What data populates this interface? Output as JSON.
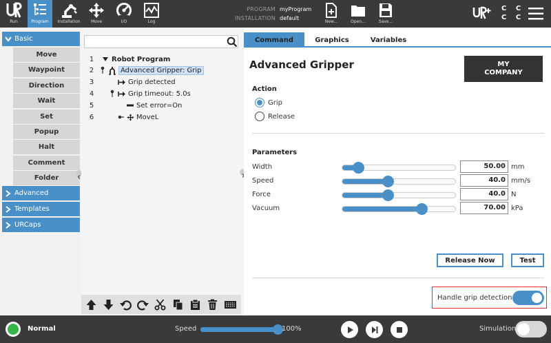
{
  "topbar": {
    "nav": [
      {
        "label": "Run",
        "icon": "ur-logo-icon"
      },
      {
        "label": "Program",
        "icon": "program-tree-icon",
        "active": true
      },
      {
        "label": "Installation",
        "icon": "robot-arm-icon"
      },
      {
        "label": "Move",
        "icon": "move-arrows-icon"
      },
      {
        "label": "I/O",
        "icon": "io-gauge-icon"
      },
      {
        "label": "Log",
        "icon": "log-chart-icon"
      }
    ],
    "program_key": "PROGRAM",
    "program_value": "myProgram",
    "installation_key": "INSTALLATION",
    "installation_value": "default",
    "file_buttons": [
      {
        "label": "New...",
        "icon": "new-file-icon"
      },
      {
        "label": "Open...",
        "icon": "open-folder-icon"
      },
      {
        "label": "Save...",
        "icon": "save-disk-icon"
      }
    ],
    "urplus_icon": "ur-plus-icon",
    "cc_text": "C C\nC C",
    "menu_icon": "hamburger-menu-icon"
  },
  "sidebar": {
    "categories": {
      "basic": "Basic",
      "advanced": "Advanced",
      "templates": "Templates",
      "urcaps": "URCaps"
    },
    "basic_items": [
      "Move",
      "Waypoint",
      "Direction",
      "Wait",
      "Set",
      "Popup",
      "Halt",
      "Comment",
      "Folder"
    ]
  },
  "tree": {
    "search_icon": "search-icon",
    "lines": [
      {
        "num": "1",
        "text": "Robot Program",
        "icon": "expand-triangle-icon"
      },
      {
        "num": "2",
        "text": "Advanced Gripper: Grip",
        "icon": "gripper-icon"
      },
      {
        "num": "3",
        "text": "Grip detected",
        "icon": "branch-arrow-icon"
      },
      {
        "num": "4",
        "text": "Grip timeout: 5.0s",
        "icon": "branch-arrow-icon"
      },
      {
        "num": "5",
        "text": "Set error=On",
        "icon": "set-io-icon"
      },
      {
        "num": "6",
        "text": "MoveL",
        "icon": "move-arrows-icon"
      }
    ],
    "toolbar_icons": [
      "move-up-icon",
      "move-down-icon",
      "undo-icon",
      "redo-icon",
      "cut-icon",
      "copy-icon",
      "paste-icon",
      "delete-icon",
      "suppress-icon"
    ]
  },
  "main": {
    "tabs": [
      "Command",
      "Graphics",
      "Variables"
    ],
    "title": "Advanced Gripper",
    "logo_text": "MY\nCOMPANY",
    "action_title": "Action",
    "action_options": [
      {
        "label": "Grip",
        "checked": true
      },
      {
        "label": "Release",
        "checked": false
      }
    ],
    "params_title": "Parameters",
    "params": [
      {
        "label": "Width",
        "value": "50.00",
        "unit": "mm",
        "level": 0.14
      },
      {
        "label": "Speed",
        "value": "40.0",
        "unit": "mm/s",
        "level": 0.4
      },
      {
        "label": "Force",
        "value": "40.0",
        "unit": "N",
        "level": 0.4
      },
      {
        "label": "Vacuum",
        "value": "70.00",
        "unit": "kPa",
        "level": 0.7
      }
    ],
    "release_now_label": "Release Now",
    "test_label": "Test",
    "grip_detection_label": "Handle grip detection",
    "grip_detection_on": true
  },
  "bottombar": {
    "status": "Normal",
    "status_color": "#33b54a",
    "speed_label": "Speed",
    "speed_value": "100%",
    "speed_level": 1.0,
    "controls": [
      "play-icon",
      "step-icon",
      "stop-icon"
    ],
    "simulation_label": "Simulation",
    "simulation_on": false
  },
  "colors": {
    "accent": "#4a90c8",
    "bar": "#3a3a3a",
    "highlight": "#e02a2a"
  }
}
